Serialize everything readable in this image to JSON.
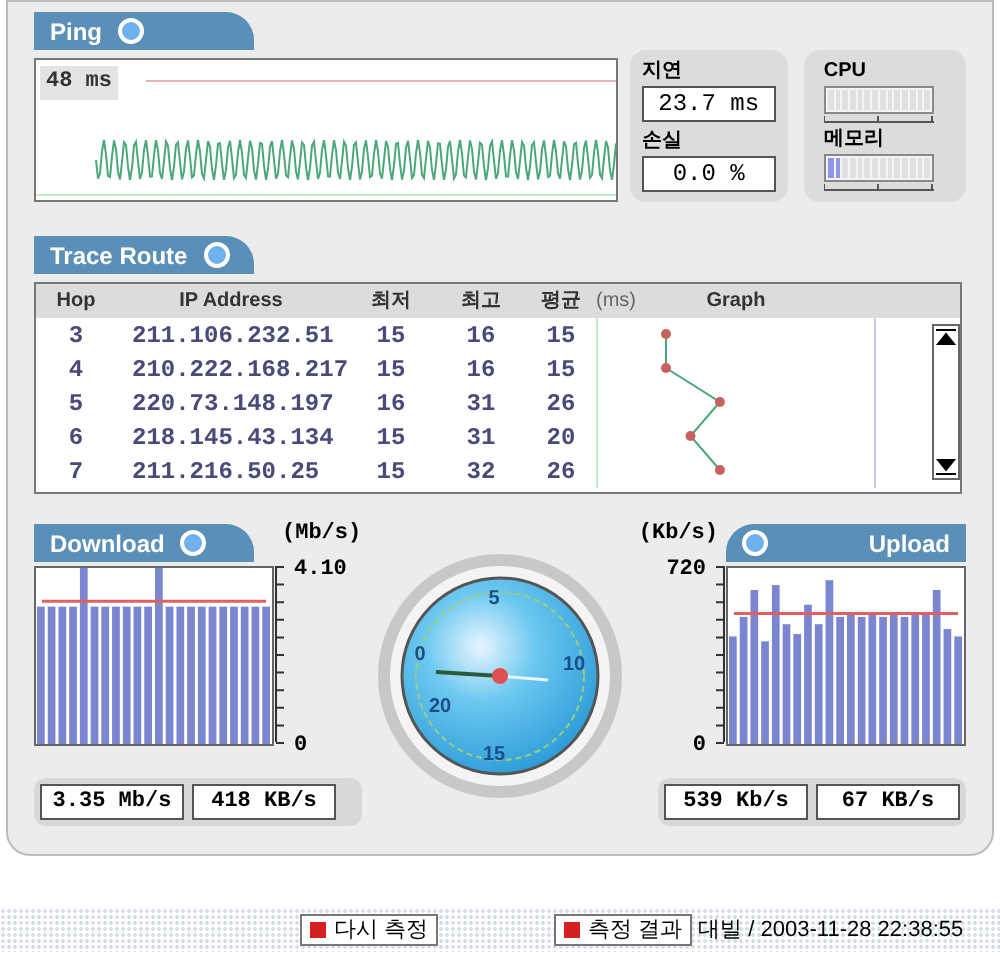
{
  "ping": {
    "tab": "Ping",
    "scale_label": "48 ms",
    "delay": {
      "label": "지연",
      "value": "23.7 ms"
    },
    "loss": {
      "label": "손실",
      "value": "0.0 %"
    },
    "cpu": {
      "label": "CPU",
      "level": 0.0
    },
    "memory": {
      "label": "메모리",
      "level": 0.15
    }
  },
  "trace_route": {
    "tab": "Trace Route",
    "columns": [
      "Hop",
      "IP Address",
      "최저",
      "최고",
      "평균"
    ],
    "unit": "(ms)",
    "graph_column": "Graph",
    "rows": [
      {
        "hop": "3",
        "ip": "211.106.232.51",
        "min": "15",
        "max": "16",
        "avg": "15"
      },
      {
        "hop": "4",
        "ip": "210.222.168.217",
        "min": "15",
        "max": "16",
        "avg": "15"
      },
      {
        "hop": "5",
        "ip": "220.73.148.197",
        "min": "16",
        "max": "31",
        "avg": "26"
      },
      {
        "hop": "6",
        "ip": "218.145.43.134",
        "min": "15",
        "max": "31",
        "avg": "20"
      },
      {
        "hop": "7",
        "ip": "211.216.50.25",
        "min": "15",
        "max": "32",
        "avg": "26"
      }
    ]
  },
  "download": {
    "tab": "Download",
    "readings": [
      "3.35 Mb/s",
      "418 KB/s"
    ],
    "chart_data": {
      "type": "bar",
      "ylabel": "(Mb/s)",
      "ylim": [
        0,
        4.1
      ],
      "yticks": [
        0,
        {
          "value": 4.1,
          "label": "4.10"
        }
      ],
      "values": [
        3.2,
        3.2,
        3.2,
        3.2,
        4.1,
        3.2,
        3.2,
        3.2,
        3.2,
        3.2,
        3.2,
        4.1,
        3.2,
        3.2,
        3.2,
        3.2,
        3.2,
        3.2,
        3.2,
        3.2,
        3.2,
        3.2
      ],
      "ref_lines": [
        {
          "axis": "y",
          "value": 3.3
        }
      ]
    }
  },
  "gauge": {
    "labels": [
      "0",
      "5",
      "10",
      "15",
      "20"
    ]
  },
  "upload": {
    "tab": "Upload",
    "readings": [
      "539 Kb/s",
      "67 KB/s"
    ],
    "chart_data": {
      "type": "bar",
      "ylabel": "(Kb/s)",
      "ylim": [
        0,
        720
      ],
      "yticks": [
        0,
        720
      ],
      "values": [
        440,
        520,
        630,
        420,
        650,
        490,
        450,
        570,
        490,
        670,
        520,
        530,
        520,
        530,
        520,
        530,
        520,
        530,
        530,
        630,
        470,
        440
      ],
      "ref_lines": [
        {
          "axis": "y",
          "value": 530
        }
      ]
    }
  },
  "footer": {
    "buttons": [
      "다시 측정",
      "측정 결과"
    ],
    "status": "대빌 / 2003-11-28 22:38:55"
  }
}
